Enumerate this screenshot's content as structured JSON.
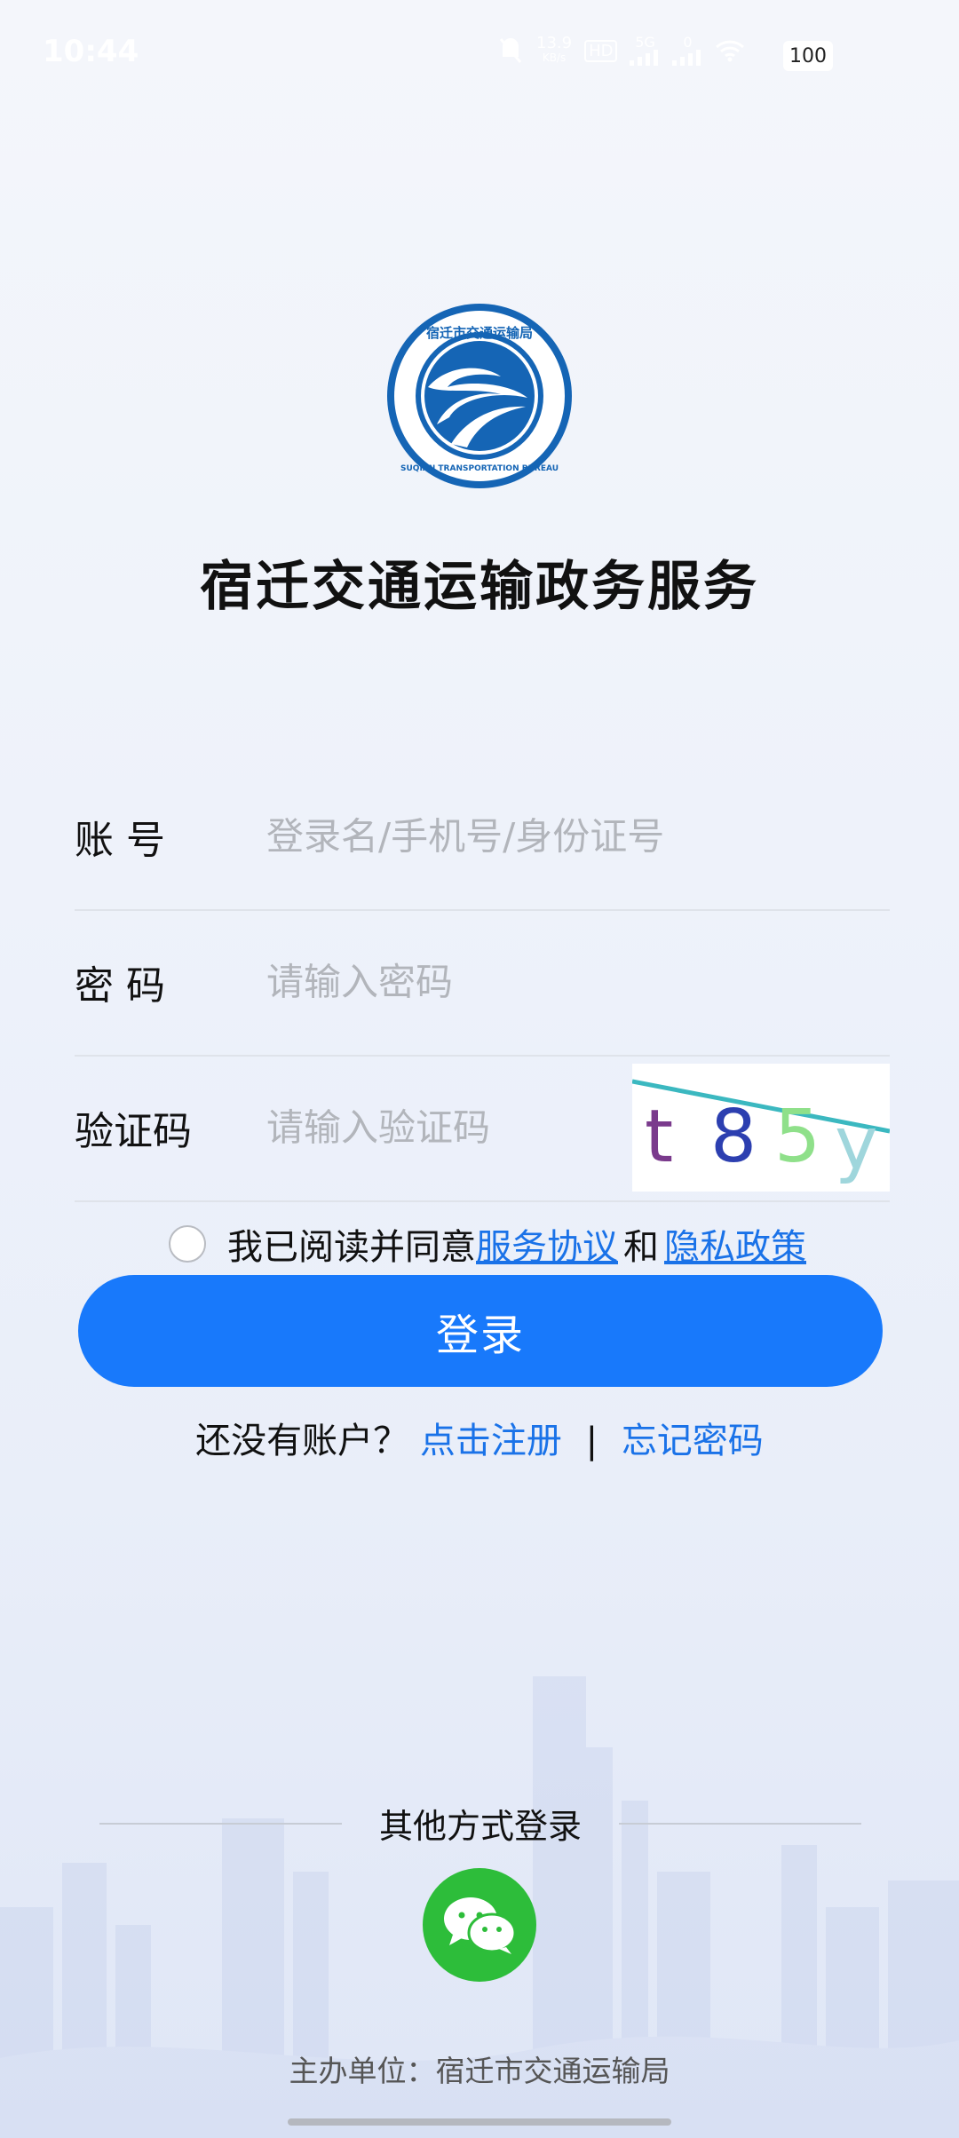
{
  "status_bar": {
    "time": "10:44",
    "net_speed": "13.9",
    "net_unit": "KB/s",
    "hd": "HD",
    "signal": "5G",
    "signal2": "0",
    "battery": "100"
  },
  "header": {
    "logo_text_top": "宿迁市交通运输局",
    "logo_text_bottom": "SUQIAN TRANSPORTATION BUREAU",
    "title": "宿迁交通运输政务服务"
  },
  "form": {
    "account_label": "账 号",
    "account_placeholder": "登录名/手机号/身份证号",
    "password_label": "密 码",
    "password_placeholder": "请输入密码",
    "captcha_label": "验证码",
    "captcha_placeholder": "请输入验证码",
    "captcha_chars": [
      "t",
      "8",
      "5",
      "y"
    ]
  },
  "agreement": {
    "prefix": "我已阅读并同意",
    "service": "服务协议",
    "and": "和",
    "privacy": "隐私政策"
  },
  "login_button": "登录",
  "register": {
    "prompt": "还没有账户？",
    "register_link": "点击注册",
    "separator": "|",
    "forgot_link": "忘记密码"
  },
  "other_login": {
    "title": "其他方式登录"
  },
  "footer": {
    "text": "主办单位：宿迁市交通运输局"
  },
  "colors": {
    "primary": "#1879fb",
    "link": "#1a72e8",
    "wechat": "#2dbd3a"
  }
}
